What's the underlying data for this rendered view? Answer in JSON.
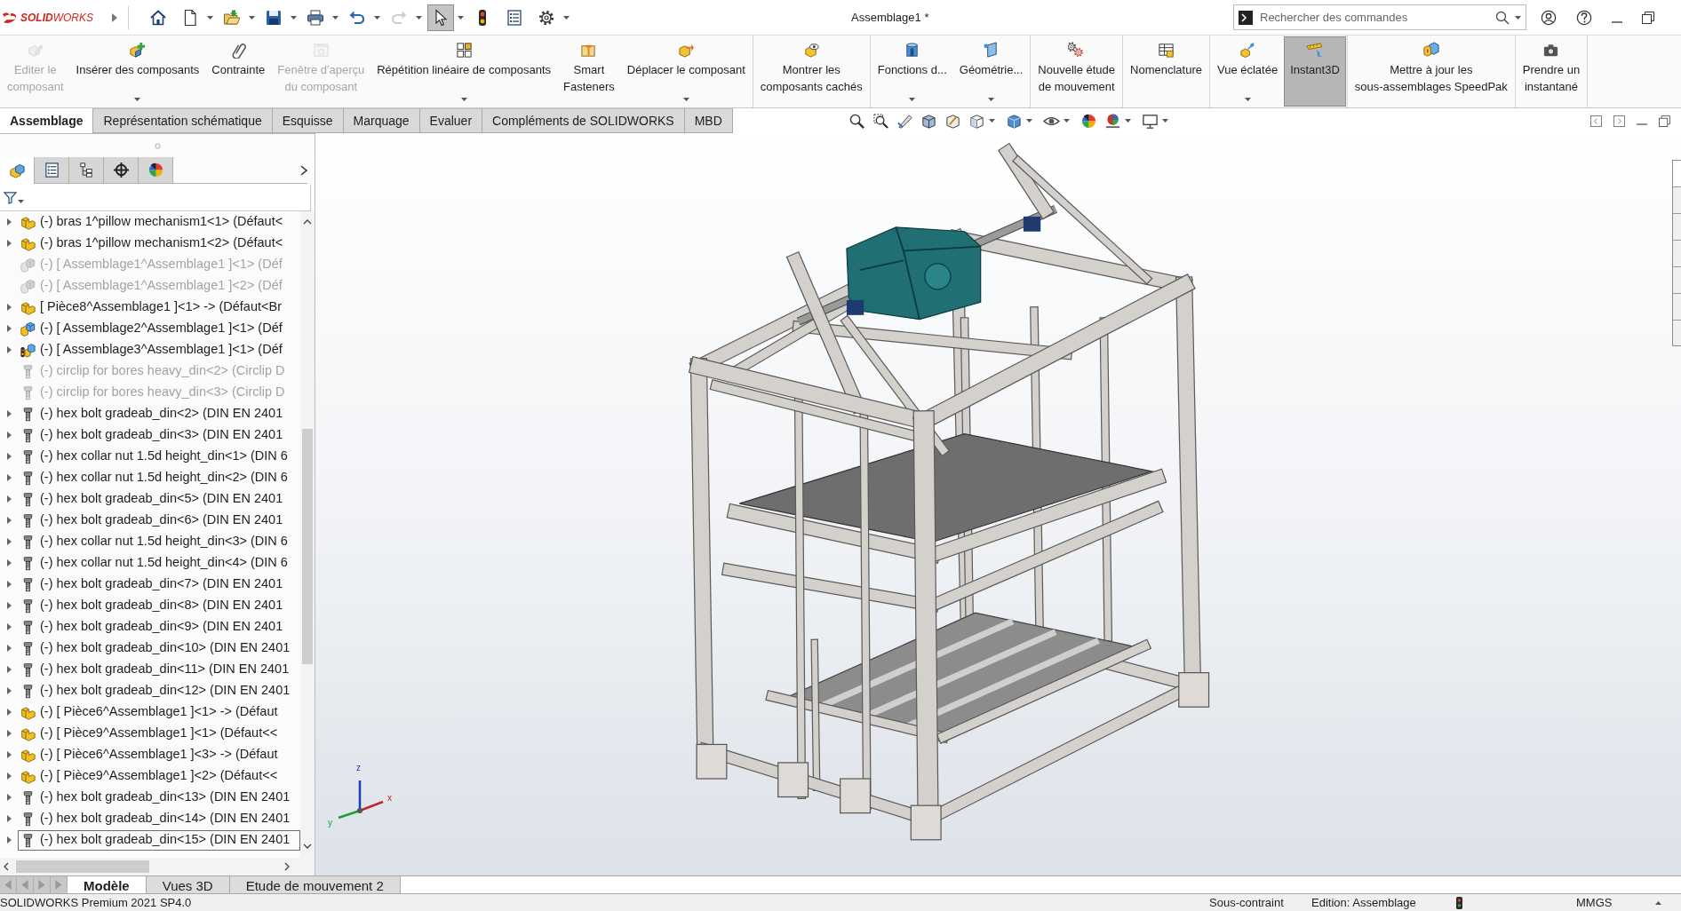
{
  "title_bar": {
    "logo": "**SOLID**WORKS",
    "title": "Assemblage1 *",
    "search": {
      "placeholder": "Rechercher des commandes"
    }
  },
  "quick_access": [
    {
      "kind": "home",
      "dropdown": false,
      "disabled": false,
      "selected": false
    },
    {
      "kind": "new",
      "dropdown": true,
      "disabled": false,
      "selected": false
    },
    {
      "kind": "open",
      "dropdown": true,
      "disabled": false,
      "selected": false
    },
    {
      "kind": "save",
      "dropdown": true,
      "disabled": false,
      "selected": false
    },
    {
      "kind": "print",
      "dropdown": true,
      "disabled": false,
      "selected": false
    },
    {
      "kind": "undo",
      "dropdown": true,
      "disabled": false,
      "selected": false
    },
    {
      "kind": "redo",
      "dropdown": true,
      "disabled": true,
      "selected": false
    },
    {
      "kind": "select",
      "dropdown": true,
      "disabled": false,
      "selected": true
    },
    {
      "kind": "rebuild",
      "dropdown": false,
      "disabled": false,
      "selected": false
    },
    {
      "kind": "properties",
      "dropdown": false,
      "disabled": false,
      "selected": false
    },
    {
      "kind": "options",
      "dropdown": true,
      "disabled": false,
      "selected": false
    }
  ],
  "ribbon": {
    "groups": [
      {
        "buttons": [
          {
            "kind": "edit",
            "label": "Editer le\ncomposant",
            "disabled": true,
            "dropdown": false,
            "selected": false
          },
          {
            "kind": "insert",
            "label": "Insérer des composants",
            "disabled": false,
            "dropdown": true,
            "selected": false
          },
          {
            "kind": "mate",
            "label": "Contrainte",
            "disabled": false,
            "dropdown": false,
            "selected": false
          },
          {
            "kind": "preview",
            "label": "Fenêtre d'aperçu\ndu composant",
            "disabled": true,
            "dropdown": false,
            "selected": false
          },
          {
            "kind": "pattern",
            "label": "Répétition linéaire de composants",
            "disabled": false,
            "dropdown": true,
            "selected": false
          },
          {
            "kind": "fasteners",
            "label": "Smart\nFasteners",
            "disabled": false,
            "dropdown": false,
            "selected": false
          },
          {
            "kind": "move",
            "label": "Déplacer le composant",
            "disabled": false,
            "dropdown": true,
            "selected": false
          }
        ]
      },
      {
        "buttons": [
          {
            "kind": "show",
            "label": "Montrer les\ncomposants cachés",
            "disabled": false,
            "dropdown": false,
            "selected": false
          }
        ]
      },
      {
        "buttons": [
          {
            "kind": "features",
            "label": "Fonctions d...",
            "disabled": false,
            "dropdown": true,
            "selected": false
          },
          {
            "kind": "geometry",
            "label": "Géométrie...",
            "disabled": false,
            "dropdown": true,
            "selected": false
          }
        ]
      },
      {
        "buttons": [
          {
            "kind": "motion",
            "label": "Nouvelle étude\nde mouvement",
            "disabled": false,
            "dropdown": false,
            "selected": false
          }
        ]
      },
      {
        "buttons": [
          {
            "kind": "bom",
            "label": "Nomenclature",
            "disabled": false,
            "dropdown": false,
            "selected": false
          }
        ]
      },
      {
        "buttons": [
          {
            "kind": "explode",
            "label": "Vue éclatée",
            "disabled": false,
            "dropdown": true,
            "selected": false
          },
          {
            "kind": "instant",
            "label": "Instant3D",
            "disabled": false,
            "dropdown": false,
            "selected": true
          }
        ]
      },
      {
        "buttons": [
          {
            "kind": "speedpak",
            "label": "Mettre à jour les\nsous-assemblages SpeedPak",
            "disabled": false,
            "dropdown": false,
            "selected": false
          }
        ]
      },
      {
        "buttons": [
          {
            "kind": "snapshot",
            "label": "Prendre un\ninstantané",
            "disabled": false,
            "dropdown": false,
            "selected": false
          }
        ]
      }
    ]
  },
  "tabs": [
    {
      "label": "Assemblage",
      "selected": true
    },
    {
      "label": "Représentation schématique",
      "selected": false
    },
    {
      "label": "Esquisse",
      "selected": false
    },
    {
      "label": "Marquage",
      "selected": false
    },
    {
      "label": "Evaluer",
      "selected": false
    },
    {
      "label": "Compléments de SOLIDWORKS",
      "selected": false
    },
    {
      "label": "MBD",
      "selected": false
    }
  ],
  "feature_manager": {
    "panel_tabs": [
      {
        "kind": "features",
        "selected": true
      },
      {
        "kind": "properties",
        "selected": false
      },
      {
        "kind": "configurations",
        "selected": false
      },
      {
        "kind": "dimxpert",
        "selected": false
      },
      {
        "kind": "display",
        "selected": false
      }
    ],
    "tree": [
      {
        "text": "(-) bras 1^pillow mechanism1<1> (Défaut<",
        "kind": "part",
        "suppressed": false,
        "selected": false
      },
      {
        "text": "(-) bras 1^pillow mechanism1<2> (Défaut<",
        "kind": "part",
        "suppressed": false,
        "selected": false
      },
      {
        "text": "(-) [ Assemblage1^Assemblage1 ]<1> (Déf",
        "kind": "assembly",
        "suppressed": true,
        "selected": false
      },
      {
        "text": "(-) [ Assemblage1^Assemblage1 ]<2> (Déf",
        "kind": "assembly",
        "suppressed": true,
        "selected": false
      },
      {
        "text": "[ Pièce8^Assemblage1 ]<1> -> (Défaut<Br",
        "kind": "part",
        "suppressed": false,
        "selected": false
      },
      {
        "text": "(-) [ Assemblage2^Assemblage1 ]<1> (Déf",
        "kind": "assembly",
        "suppressed": false,
        "selected": false
      },
      {
        "text": "(-) [ Assemblage3^Assemblage1 ]<1> (Déf",
        "kind": "flagged",
        "suppressed": false,
        "selected": false
      },
      {
        "text": "(-) circlip for bores heavy_din<2> (Circlip D",
        "kind": "fastener",
        "suppressed": true,
        "selected": false
      },
      {
        "text": "(-) circlip for bores heavy_din<3> (Circlip D",
        "kind": "fastener",
        "suppressed": true,
        "selected": false
      },
      {
        "text": "(-) hex bolt gradeab_din<2> (DIN EN 2401",
        "kind": "fastener",
        "suppressed": false,
        "selected": false
      },
      {
        "text": "(-) hex bolt gradeab_din<3> (DIN EN 2401",
        "kind": "fastener",
        "suppressed": false,
        "selected": false
      },
      {
        "text": "(-) hex collar nut 1.5d height_din<1> (DIN 6",
        "kind": "fastener",
        "suppressed": false,
        "selected": false
      },
      {
        "text": "(-) hex collar nut 1.5d height_din<2> (DIN 6",
        "kind": "fastener",
        "suppressed": false,
        "selected": false
      },
      {
        "text": "(-) hex bolt gradeab_din<5> (DIN EN 2401",
        "kind": "fastener",
        "suppressed": false,
        "selected": false
      },
      {
        "text": "(-) hex bolt gradeab_din<6> (DIN EN 2401",
        "kind": "fastener",
        "suppressed": false,
        "selected": false
      },
      {
        "text": "(-) hex collar nut 1.5d height_din<3> (DIN 6",
        "kind": "fastener",
        "suppressed": false,
        "selected": false
      },
      {
        "text": "(-) hex collar nut 1.5d height_din<4> (DIN 6",
        "kind": "fastener",
        "suppressed": false,
        "selected": false
      },
      {
        "text": "(-) hex bolt gradeab_din<7> (DIN EN 2401",
        "kind": "fastener",
        "suppressed": false,
        "selected": false
      },
      {
        "text": "(-) hex bolt gradeab_din<8> (DIN EN 2401",
        "kind": "fastener",
        "suppressed": false,
        "selected": false
      },
      {
        "text": "(-) hex bolt gradeab_din<9> (DIN EN 2401",
        "kind": "fastener",
        "suppressed": false,
        "selected": false
      },
      {
        "text": "(-) hex bolt gradeab_din<10> (DIN EN 2401",
        "kind": "fastener",
        "suppressed": false,
        "selected": false
      },
      {
        "text": "(-) hex bolt gradeab_din<11> (DIN EN 2401",
        "kind": "fastener",
        "suppressed": false,
        "selected": false
      },
      {
        "text": "(-) hex bolt gradeab_din<12> (DIN EN 2401",
        "kind": "fastener",
        "suppressed": false,
        "selected": false
      },
      {
        "text": "(-) [ Pièce6^Assemblage1 ]<1> -> (Défaut",
        "kind": "part",
        "suppressed": false,
        "selected": false
      },
      {
        "text": "(-) [ Pièce9^Assemblage1 ]<1> (Défaut<<",
        "kind": "part",
        "suppressed": false,
        "selected": false
      },
      {
        "text": "(-) [ Pièce6^Assemblage1 ]<3> -> (Défaut",
        "kind": "part",
        "suppressed": false,
        "selected": false
      },
      {
        "text": "(-) [ Pièce9^Assemblage1 ]<2> (Défaut<<",
        "kind": "part",
        "suppressed": false,
        "selected": false
      },
      {
        "text": "(-) hex bolt gradeab_din<13> (DIN EN 2401",
        "kind": "fastener",
        "suppressed": false,
        "selected": false
      },
      {
        "text": "(-) hex bolt gradeab_din<14> (DIN EN 2401",
        "kind": "fastener",
        "suppressed": false,
        "selected": false
      },
      {
        "text": "(-) hex bolt gradeab_din<15> (DIN EN 2401",
        "kind": "fastener",
        "suppressed": false,
        "selected": true
      }
    ]
  },
  "graphics": {
    "triad_labels": [
      "z",
      "x",
      "y"
    ]
  },
  "bottom_tabs": [
    {
      "label": "Modèle",
      "selected": true
    },
    {
      "label": "Vues 3D",
      "selected": false
    },
    {
      "label": "Etude de mouvement 2",
      "selected": false
    }
  ],
  "status_bar": {
    "product": "SOLIDWORKS Premium 2021 SP4.0",
    "state": "Sous-contraint",
    "mode": "Edition: Assemblage",
    "units": "MMGS"
  }
}
